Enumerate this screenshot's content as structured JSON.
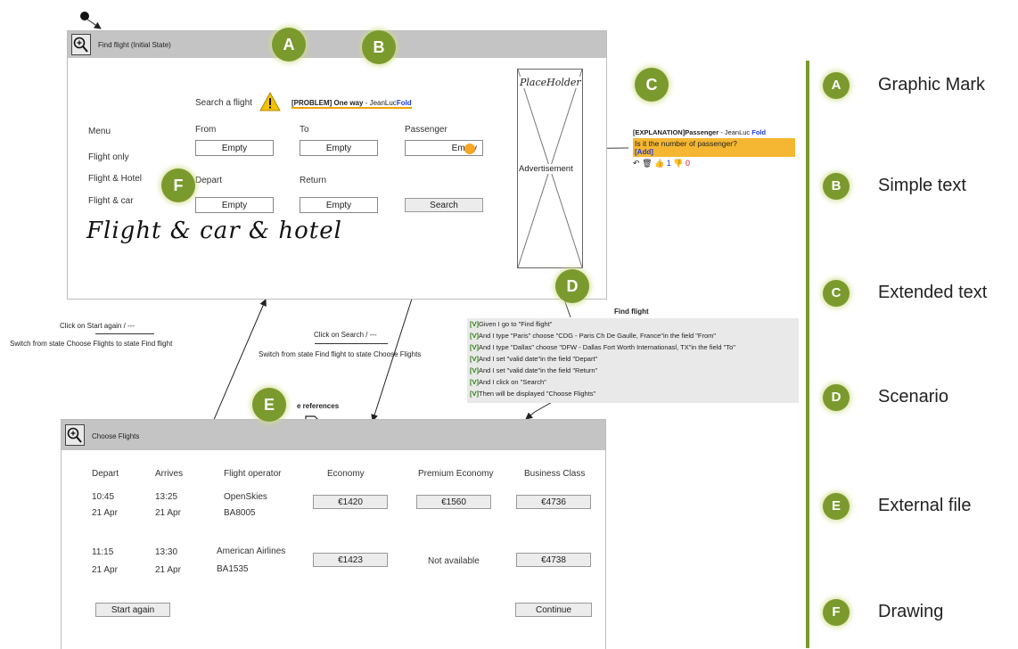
{
  "screen1": {
    "title": "Find flight   (Initial State)",
    "search_label": "Search a flight",
    "problem": {
      "tag": "[PROBLEM] One way",
      "sep": " - ",
      "author": "JeanLuc",
      "fold": "Fold"
    },
    "menu": [
      "Menu",
      "Flight only",
      "Flight & Hotel",
      "Flight & car"
    ],
    "from_label": "From",
    "to_label": "To",
    "passenger_label": "Passenger",
    "depart_label": "Depart",
    "return_label": "Return",
    "empty": "Empty",
    "search_button": "Search",
    "placeholder_label": "PlaceHolder",
    "ad_label": "Advertisement",
    "handwriting": "Flight & car & hotel"
  },
  "comment": {
    "tag": "[EXPLANATION]Passenger",
    "sep": " - ",
    "author": "JeanLuc",
    "fold": "Fold",
    "text": "Is it the number of passenger?",
    "add": "[Add]",
    "likes": "1",
    "dislikes": "0"
  },
  "transitions": {
    "start": {
      "action": "Click on Start again  /  ---",
      "desc": "Switch from state Choose Flights to state Find flight"
    },
    "search": {
      "action": "Click on Search  /  ---",
      "desc": "Switch from state Find flight to state Choose Flights"
    }
  },
  "scenario": {
    "title": "Find flight",
    "lines": [
      {
        "tag": "[V]",
        "text": "Given I go to \"Find flight\""
      },
      {
        "tag": "[V]",
        "text": "And I type \"Paris\" choose \"CDG - Paris Ch De Gaulle, France\"in the field \"From\""
      },
      {
        "tag": "[V]",
        "text": "And I type \"Dallas\" choose \"DFW - Dallas Fort Worth Internationasl, TX\"in the field \"To\""
      },
      {
        "tag": "[V]",
        "text": "And I set \"valid date\"in the field \"Depart\""
      },
      {
        "tag": "[V]",
        "text": "And I set \"valid date\"in the field \"Return\""
      },
      {
        "tag": "[V]",
        "text": "And I click on \"Search\""
      },
      {
        "tag": "[V]",
        "text": "Then will be displayed \"Choose Flights\""
      }
    ]
  },
  "external_ref": "e references",
  "screen2": {
    "title": "Choose Flights",
    "headers": [
      "Depart",
      "Arrives",
      "Flight operator",
      "Economy",
      "Premium Economy",
      "Business Class"
    ],
    "rows": [
      {
        "depart": "10:45",
        "depart_date": "21 Apr",
        "arrive": "13:25",
        "arrive_date": "21 Apr",
        "operator": "OpenSkies",
        "code": "BA8005",
        "economy": "€1420",
        "premium": "€1560",
        "business": "€4736"
      },
      {
        "depart": "11:15",
        "depart_date": "21 Apr",
        "arrive": "13:30",
        "arrive_date": "21 Apr",
        "operator": "American Airlines",
        "code": "BA1535",
        "economy": "€1423",
        "premium": "Not available",
        "business": "€4738"
      }
    ],
    "start_again": "Start again",
    "continue": "Continue"
  },
  "badges": [
    "A",
    "B",
    "C",
    "D",
    "E",
    "F"
  ],
  "legend": [
    {
      "letter": "A",
      "text": "Graphic Mark"
    },
    {
      "letter": "B",
      "text": "Simple text"
    },
    {
      "letter": "C",
      "text": "Extended text"
    },
    {
      "letter": "D",
      "text": "Scenario"
    },
    {
      "letter": "E",
      "text": "External file"
    },
    {
      "letter": "F",
      "text": "Drawing"
    }
  ],
  "colors": {
    "badge": "#7a9a2e",
    "legend_bar": "#7a9a2e",
    "comment_bg": "#f5b731",
    "link": "#1e3cd8",
    "check": "#2f7d10",
    "warning": "#f2c200"
  }
}
